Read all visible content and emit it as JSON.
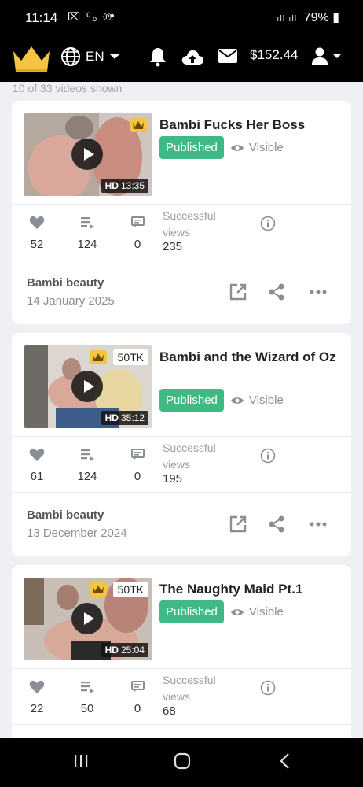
{
  "status_bar": {
    "time": "11:14",
    "left_icons": "⌧ ⁰₀ ℗",
    "dot": "•",
    "signal": "ıll ıll",
    "battery": "79%"
  },
  "app_bar": {
    "language": "EN",
    "balance": "$152.44",
    "brand_color": "#f6c343"
  },
  "list_summary": "10 of 33 videos shown",
  "colors": {
    "published": "#3fba85",
    "background": "#eef0f3"
  },
  "videos": [
    {
      "title": "Bambi Fucks Her Boss",
      "quality": "HD",
      "duration": "13:35",
      "tk_badge": "",
      "status": "Published",
      "visibility": "Visible",
      "likes": "52",
      "playlists": "124",
      "comments": "0",
      "successful_views_label": "Successful views",
      "successful_views": "235",
      "author": "Bambi beauty",
      "date": "14 January 2025"
    },
    {
      "title": "Bambi and the Wizard of Oz",
      "quality": "HD",
      "duration": "35:12",
      "tk_badge": "50TK",
      "status": "Published",
      "visibility": "Visible",
      "likes": "61",
      "playlists": "124",
      "comments": "0",
      "successful_views_label": "Successful views",
      "successful_views": "195",
      "author": "Bambi beauty",
      "date": "13 December 2024"
    },
    {
      "title": "The Naughty Maid Pt.1",
      "quality": "HD",
      "duration": "25:04",
      "tk_badge": "50TK",
      "status": "Published",
      "visibility": "Visible",
      "likes": "22",
      "playlists": "50",
      "comments": "0",
      "successful_views_label": "Successful views",
      "successful_views": "68"
    }
  ]
}
